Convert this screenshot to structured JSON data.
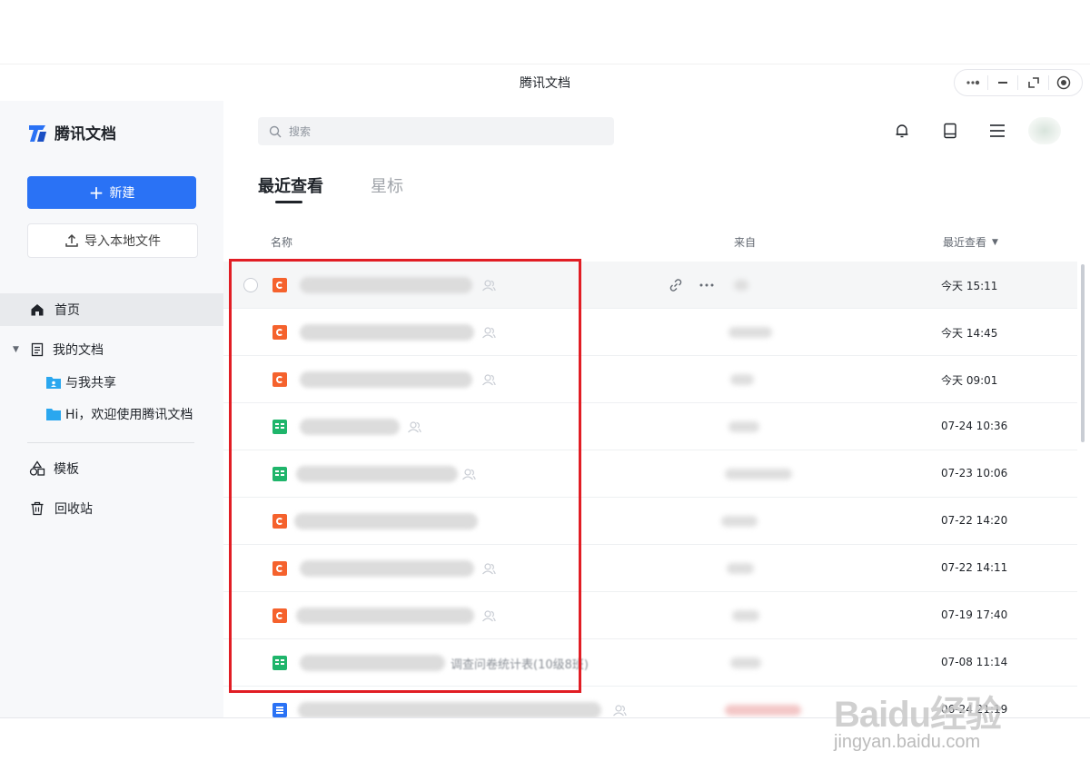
{
  "window": {
    "title": "腾讯文档"
  },
  "sidebar": {
    "logo_text": "腾讯文档",
    "new_button": "新建",
    "import_button": "导入本地文件",
    "items": [
      {
        "label": "首页",
        "icon": "home-icon",
        "active": true
      },
      {
        "label": "我的文档",
        "icon": "document-icon",
        "expanded": true
      },
      {
        "label": "与我共享",
        "icon": "shared-folder-icon"
      },
      {
        "label": "Hi，欢迎使用腾讯文档",
        "icon": "folder-icon"
      },
      {
        "label": "模板",
        "icon": "template-icon"
      },
      {
        "label": "回收站",
        "icon": "trash-icon"
      }
    ]
  },
  "header": {
    "search_placeholder": "搜索",
    "icons": [
      "bell-icon",
      "tablet-icon",
      "menu-icon",
      "avatar"
    ]
  },
  "tabs": [
    {
      "label": "最近查看",
      "active": true
    },
    {
      "label": "星标",
      "active": false
    }
  ],
  "table": {
    "columns": {
      "name": "名称",
      "from": "来自",
      "recent": "最近查看"
    },
    "rows": [
      {
        "type": "ppt",
        "time": "今天 15:11",
        "hover": true
      },
      {
        "type": "ppt",
        "time": "今天 14:45"
      },
      {
        "type": "ppt",
        "time": "今天 09:01"
      },
      {
        "type": "sheet",
        "time": "07-24 10:36"
      },
      {
        "type": "sheet",
        "time": "07-23 10:06"
      },
      {
        "type": "ppt",
        "time": "07-22 14:20"
      },
      {
        "type": "ppt",
        "time": "07-22 14:11"
      },
      {
        "type": "ppt",
        "time": "07-19 17:40"
      },
      {
        "type": "sheet",
        "time": "07-08 11:14",
        "title_suffix": "调查问卷统计表(10级8班)"
      },
      {
        "type": "doc",
        "time": "06-24 21:19"
      }
    ]
  },
  "watermark": {
    "brand": "Baidu经验",
    "site": "jingyan.baidu.com"
  },
  "colors": {
    "accent": "#2a72f5",
    "highlight": "#e11d24",
    "ppt": "#f5622d",
    "sheet": "#1fb56b",
    "doc": "#2a72f5"
  }
}
